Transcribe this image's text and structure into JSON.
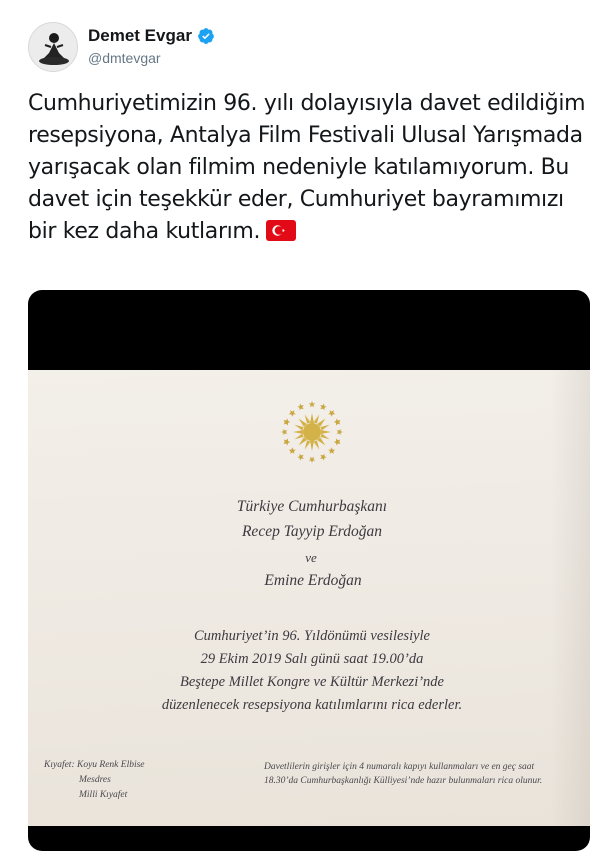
{
  "user": {
    "display_name": "Demet Evgar",
    "handle": "@dmtevgar",
    "verified_icon": "verified-badge-icon",
    "verified_color": "#1da1f2"
  },
  "tweet": {
    "text": "Cumhuriyetimizin 96. yılı dolayısıyla davet edildiğim resepsiyona, Antalya Film Festivali Ulusal Yarışmada yarışacak olan filmim nedeniyle katılamıyorum. Bu davet için teşekkür eder, Cumhuriyet bayramımızı bir kez daha kutlarım.",
    "flag_emoji": "turkey-flag-icon",
    "flag_color": "#e30a17"
  },
  "invitation": {
    "line1": "Türkiye Cumhurbaşkanı",
    "line2": "Recep Tayyip Erdoğan",
    "line3": "ve",
    "line4": "Emine Erdoğan",
    "para1": "Cumhuriyet’in 96. Yıldönümü vesilesiyle",
    "para2": "29 Ekim 2019 Salı günü saat 19.00’da",
    "para3": "Beştepe Millet Kongre ve Kültür Merkezi’nde",
    "para4": "düzenlenecek resepsiyona katılımlarını rica ederler.",
    "dress_label": "Kıyafet: Koyu Renk Elbise",
    "dress2": "Mesdres",
    "dress3": "Milli Kıyafet",
    "note1": "Davetlilerin girişler için 4 numaralı kapıyı kullanmaları ve en geç saat",
    "note2": "18.30’da Cumhurbaşkanlığı Külliyesi’nde hazır bulunmaları rica olunur.",
    "emblem_icon": "presidential-sun-emblem-icon",
    "emblem_color": "#c9a640"
  }
}
